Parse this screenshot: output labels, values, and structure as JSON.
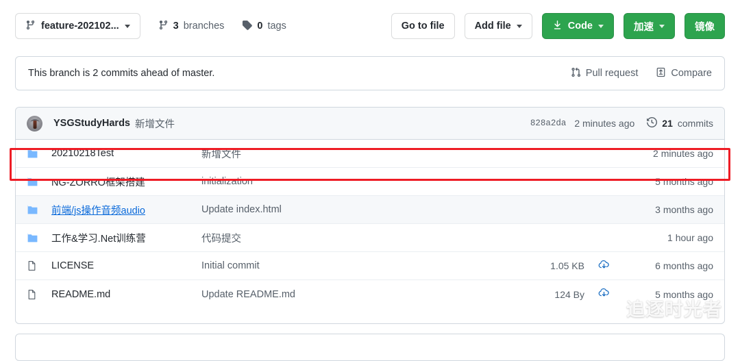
{
  "toolbar": {
    "branch_button": {
      "label": "feature-202102...",
      "icon": "branch-icon"
    },
    "branches": {
      "count": "3",
      "label": "branches",
      "icon": "branch-icon"
    },
    "tags": {
      "count": "0",
      "label": "tags",
      "icon": "tag-icon"
    },
    "go_to_file": "Go to file",
    "add_file": "Add file",
    "code": "Code",
    "accelerate": "加速",
    "mirror": "镜像",
    "accent_green": "#2da44e"
  },
  "status_bar": {
    "text": "This branch is 2 commits ahead of master.",
    "pull_request": "Pull request",
    "compare": "Compare"
  },
  "commit_header": {
    "author": "YSGStudyHards",
    "message": "新增文件",
    "sha": "828a2da",
    "time": "2 minutes ago",
    "commits_count": "21",
    "commits_label": "commits"
  },
  "files": {
    "rows": [
      {
        "type": "folder",
        "name": "20210218Test",
        "message": "新增文件",
        "size": "",
        "download": false,
        "time": "2 minutes ago",
        "hovered": false,
        "highlighted": true
      },
      {
        "type": "folder",
        "name": "NG-ZORRO框架搭建",
        "message": "initialization",
        "size": "",
        "download": false,
        "time": "5 months ago",
        "hovered": false,
        "highlighted": false
      },
      {
        "type": "folder",
        "name": "前端/js操作音频audio",
        "message": "Update index.html",
        "size": "",
        "download": false,
        "time": "3 months ago",
        "hovered": true,
        "highlighted": false
      },
      {
        "type": "folder",
        "name": "工作&学习.Net训练营",
        "message": "代码提交",
        "size": "",
        "download": false,
        "time": "1 hour ago",
        "hovered": false,
        "highlighted": false
      },
      {
        "type": "file",
        "name": "LICENSE",
        "message": "Initial commit",
        "size": "1.05 KB",
        "download": true,
        "time": "6 months ago",
        "hovered": false,
        "highlighted": false
      },
      {
        "type": "file",
        "name": "README.md",
        "message": "Update README.md",
        "size": "124 By",
        "download": true,
        "time": "5 months ago",
        "hovered": false,
        "highlighted": false
      }
    ]
  },
  "annotation": {
    "color": "#ee1c25"
  },
  "watermark": {
    "text": "追逐时光者",
    "icon": "wechat-icon"
  }
}
